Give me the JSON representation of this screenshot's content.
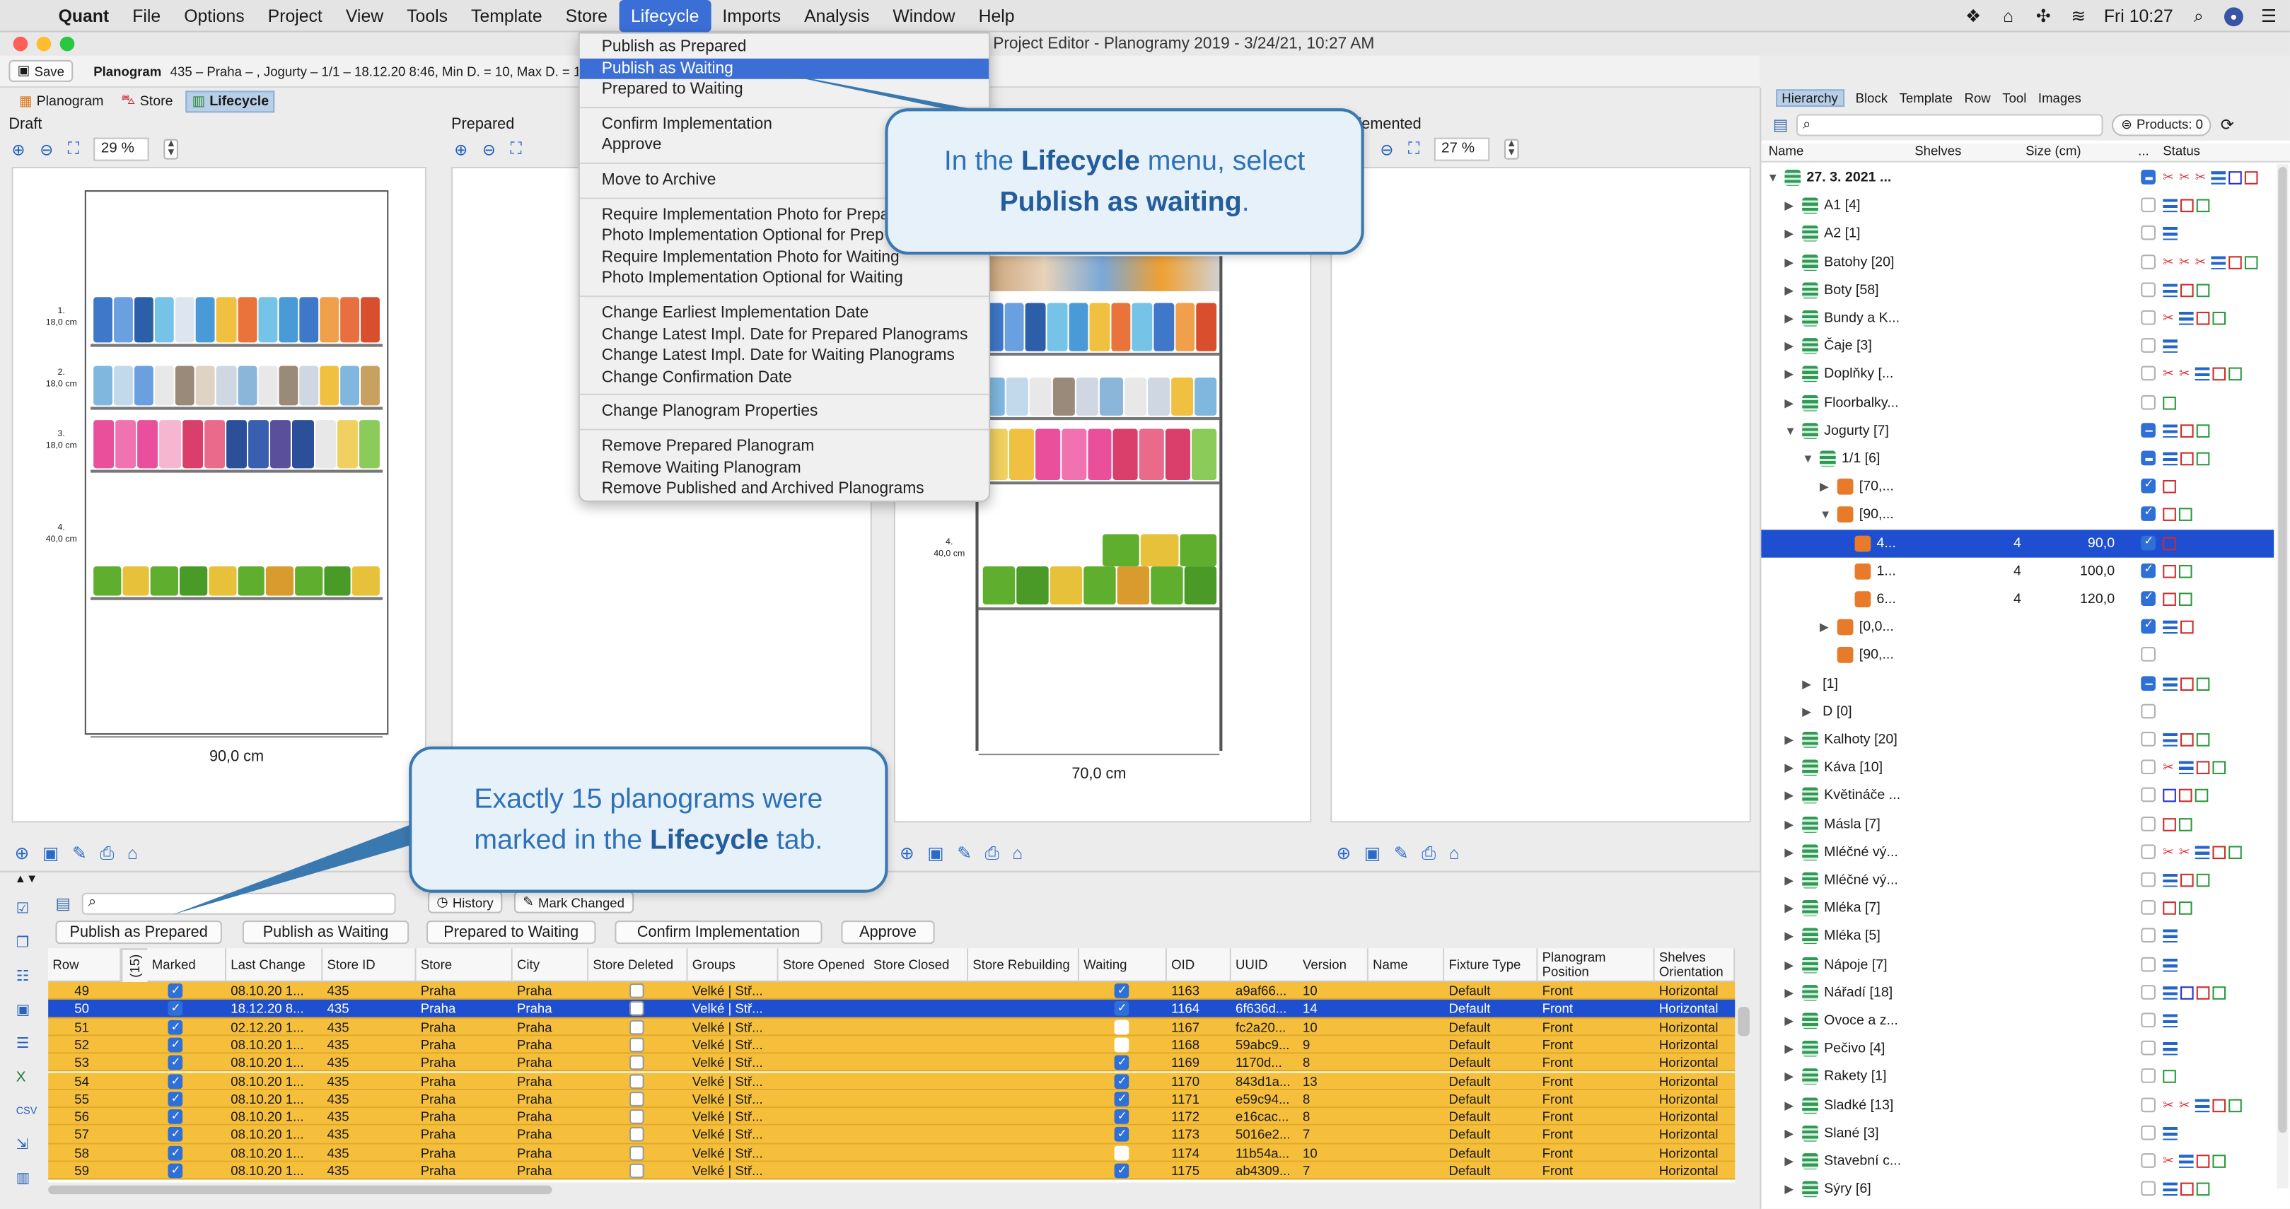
{
  "menubar": {
    "app": "Quant",
    "items": [
      "File",
      "Options",
      "Project",
      "View",
      "Tools",
      "Template",
      "Store",
      "Lifecycle",
      "Imports",
      "Analysis",
      "Window",
      "Help"
    ],
    "active": "Lifecycle",
    "clock": "Fri 10:27"
  },
  "window": {
    "title": "Project Editor - Planogramy 2019 - 3/24/21, 10:27 AM"
  },
  "toolbar": {
    "save": "Save",
    "planogram_label": "Planogram",
    "planogram_info": "435 – Praha – , Jogurty – 1/1 – 18.12.20 8:46, Min D. = 10, Max D. = 10, POPS"
  },
  "modes": {
    "planogram": "Planogram",
    "store": "Store",
    "lifecycle": "Lifecycle"
  },
  "panels": {
    "draft": {
      "title": "Draft",
      "zoom": "29 %",
      "width_label": "90,0 cm"
    },
    "prepared": {
      "title": "Prepared"
    },
    "waiting": {
      "width_label": "70,0 cm"
    },
    "implemented": {
      "title": "lemented",
      "zoom": "27 %"
    }
  },
  "shelf_labels": {
    "s1": [
      "1.",
      "18,0 cm"
    ],
    "s2": [
      "2.",
      "18,0 cm"
    ],
    "s3": [
      "3.",
      "18,0 cm"
    ],
    "s4": [
      "4.",
      "40,0 cm"
    ]
  },
  "menu": {
    "items": [
      [
        "Publish as Prepared",
        "Publish as Waiting",
        "Prepared to Waiting"
      ],
      [
        "Confirm Implementation",
        "Approve"
      ],
      [
        "Move to Archive"
      ],
      [
        "Require Implementation Photo for Prepa",
        "Photo Implementation Optional for Prep",
        "Require Implementation Photo for Waiting",
        "Photo Implementation Optional for Waiting"
      ],
      [
        "Change Earliest Implementation Date",
        "Change Latest Impl. Date for Prepared Planograms",
        "Change Latest Impl. Date for Waiting Planograms",
        "Change Confirmation Date"
      ],
      [
        "Change Planogram Properties"
      ],
      [
        "Remove Prepared Planogram",
        "Remove Waiting Planogram",
        "Remove Published and Archived Planograms"
      ]
    ],
    "highlighted": "Publish as Waiting"
  },
  "callouts": {
    "top": {
      "pre": "In the ",
      "b1": "Lifecycle",
      "mid": " menu, select",
      "b2": "Publish as waiting",
      "post": "."
    },
    "bottom": {
      "line1": "Exactly 15 planograms were",
      "pre": "marked in the ",
      "b1": "Lifecycle",
      "post": " tab."
    }
  },
  "right": {
    "tabs": [
      "Hierarchy",
      "Block",
      "Template",
      "Row",
      "Tool",
      "Images"
    ],
    "products": "Products: 0",
    "columns": {
      "name": "Name",
      "shelves": "Shelves",
      "size": "Size (cm)",
      "dots": "...",
      "status": "Status"
    },
    "rows": [
      {
        "n": "27. 3. 2021 ...",
        "lvl": 0,
        "open": true,
        "icon": "list",
        "cb": "mix",
        "st": "sc,sc,sc,lst,b,r",
        "bold": true
      },
      {
        "n": "A1 [4]",
        "lvl": 1,
        "icon": "list",
        "cb": "",
        "st": "lst,r,g"
      },
      {
        "n": "A2 [1]",
        "lvl": 1,
        "icon": "list",
        "cb": "",
        "st": "lst"
      },
      {
        "n": "Batohy [20]",
        "lvl": 1,
        "icon": "list",
        "cb": "",
        "st": "sc,sc,sc,lst,r,g"
      },
      {
        "n": "Boty [58]",
        "lvl": 1,
        "icon": "list",
        "cb": "",
        "st": "lst,r,g"
      },
      {
        "n": "Bundy a K...",
        "lvl": 1,
        "icon": "list",
        "cb": "",
        "st": "sc,lst,r,g"
      },
      {
        "n": "Čaje [3]",
        "lvl": 1,
        "icon": "list",
        "cb": "",
        "st": "lst"
      },
      {
        "n": "Doplňky [...",
        "lvl": 1,
        "icon": "list",
        "cb": "",
        "st": "sc,sc,lst,r,g"
      },
      {
        "n": "Floorbalky...",
        "lvl": 1,
        "icon": "list",
        "cb": "",
        "st": "g"
      },
      {
        "n": "Jogurty [7]",
        "lvl": 1,
        "open": true,
        "icon": "list",
        "cb": "mix",
        "st": "lst,r,g"
      },
      {
        "n": "1/1 [6]",
        "lvl": 2,
        "open": true,
        "icon": "list",
        "cb": "mix",
        "st": "lst,r,g"
      },
      {
        "n": "[70,...",
        "lvl": 3,
        "icon": "or",
        "cb": "on",
        "st": "r"
      },
      {
        "n": "[90,...",
        "lvl": 3,
        "open": true,
        "icon": "or",
        "cb": "on",
        "st": "r,g"
      },
      {
        "n": "4...",
        "lvl": 4,
        "icon": "or",
        "cb": "on",
        "sh": "4",
        "sz": "90,0",
        "st": "r",
        "sel": true
      },
      {
        "n": "1...",
        "lvl": 4,
        "icon": "or",
        "cb": "on",
        "sh": "4",
        "sz": "100,0",
        "st": "r,g"
      },
      {
        "n": "6...",
        "lvl": 4,
        "icon": "or",
        "cb": "on",
        "sh": "4",
        "sz": "120,0",
        "st": "r,g"
      },
      {
        "n": "[0,0...",
        "lvl": 3,
        "icon": "or",
        "cb": "on",
        "st": "lst,r"
      },
      {
        "n": "[90,...",
        "lvl": 3,
        "icon": "or",
        "cb": "",
        "st": ""
      },
      {
        "n": "[1]",
        "lvl": 2,
        "icon": "",
        "cb": "mix",
        "st": "lst,r,g"
      },
      {
        "n": "D [0]",
        "lvl": 2,
        "icon": "",
        "cb": "",
        "st": ""
      },
      {
        "n": "Kalhoty [20]",
        "lvl": 1,
        "icon": "list",
        "cb": "",
        "st": "lst,r,g"
      },
      {
        "n": "Káva [10]",
        "lvl": 1,
        "icon": "list",
        "cb": "",
        "st": "sc,lst,r,g"
      },
      {
        "n": "Květináče ...",
        "lvl": 1,
        "icon": "list",
        "cb": "",
        "st": "b,r,g"
      },
      {
        "n": "Másla [7]",
        "lvl": 1,
        "icon": "list",
        "cb": "",
        "st": "r,g"
      },
      {
        "n": "Mléčné vý...",
        "lvl": 1,
        "icon": "list",
        "cb": "",
        "st": "sc,sc,lst,r,g"
      },
      {
        "n": "Mléčné vý...",
        "lvl": 1,
        "icon": "list",
        "cb": "",
        "st": "lst,r,g"
      },
      {
        "n": "Mléka [7]",
        "lvl": 1,
        "icon": "list",
        "cb": "",
        "st": "r,g"
      },
      {
        "n": "Mléka [5]",
        "lvl": 1,
        "icon": "list",
        "cb": "",
        "st": "lst"
      },
      {
        "n": "Nápoje [7]",
        "lvl": 1,
        "icon": "list",
        "cb": "",
        "st": "lst"
      },
      {
        "n": "Nářadí [18]",
        "lvl": 1,
        "icon": "list",
        "cb": "",
        "st": "lst,b,r,g"
      },
      {
        "n": "Ovoce a z...",
        "lvl": 1,
        "icon": "list",
        "cb": "",
        "st": "lst"
      },
      {
        "n": "Pečivo [4]",
        "lvl": 1,
        "icon": "list",
        "cb": "",
        "st": "lst"
      },
      {
        "n": "Rakety [1]",
        "lvl": 1,
        "icon": "list",
        "cb": "",
        "st": "g"
      },
      {
        "n": "Sladké [13]",
        "lvl": 1,
        "icon": "list",
        "cb": "",
        "st": "sc,sc,lst,r,g"
      },
      {
        "n": "Slané [3]",
        "lvl": 1,
        "icon": "list",
        "cb": "",
        "st": "lst"
      },
      {
        "n": "Stavební c...",
        "lvl": 1,
        "icon": "list",
        "cb": "",
        "st": "sc,lst,r,g"
      },
      {
        "n": "Sýry [6]",
        "lvl": 1,
        "icon": "list",
        "cb": "",
        "st": "lst,r,g"
      }
    ]
  },
  "bottom": {
    "history": "History",
    "mark_changed": "Mark Changed",
    "actions": [
      "Publish as Prepared",
      "Publish as Waiting",
      "Prepared to Waiting",
      "Confirm Implementation",
      "Approve"
    ],
    "columns": [
      "Row",
      "(15)",
      "Marked",
      "Last Change",
      "Store ID",
      "Store",
      "City",
      "Store Deleted",
      "Groups",
      "Store Opened",
      "Store Closed",
      "Store Rebuilding",
      "Waiting",
      "OID",
      "UUID",
      "Version",
      "Name",
      "Fixture Type",
      "Planogram Position",
      "Shelves Orientation"
    ],
    "rows": [
      [
        "49",
        "08.10.20 1...",
        "435",
        "Praha",
        "Praha",
        "Velké | Stř...",
        true,
        "1163",
        "a9af66...",
        "10",
        "Default",
        "Front",
        "Horizontal"
      ],
      [
        "50",
        "18.12.20 8...",
        "435",
        "Praha",
        "Praha",
        "Velké | Stř...",
        true,
        "1164",
        "6f636d...",
        "14",
        "Default",
        "Front",
        "Horizontal"
      ],
      [
        "51",
        "02.12.20 1...",
        "435",
        "Praha",
        "Praha",
        "Velké | Stř...",
        false,
        "1167",
        "fc2a20...",
        "10",
        "Default",
        "Front",
        "Horizontal"
      ],
      [
        "52",
        "08.10.20 1...",
        "435",
        "Praha",
        "Praha",
        "Velké | Stř...",
        false,
        "1168",
        "59abc9...",
        "9",
        "Default",
        "Front",
        "Horizontal"
      ],
      [
        "53",
        "08.10.20 1...",
        "435",
        "Praha",
        "Praha",
        "Velké | Stř...",
        true,
        "1169",
        "1170d...",
        "8",
        "Default",
        "Front",
        "Horizontal"
      ],
      [
        "54",
        "08.10.20 1...",
        "435",
        "Praha",
        "Praha",
        "Velké | Stř...",
        true,
        "1170",
        "843d1a...",
        "13",
        "Default",
        "Front",
        "Horizontal"
      ],
      [
        "55",
        "08.10.20 1...",
        "435",
        "Praha",
        "Praha",
        "Velké | Stř...",
        true,
        "1171",
        "e59c94...",
        "8",
        "Default",
        "Front",
        "Horizontal"
      ],
      [
        "56",
        "08.10.20 1...",
        "435",
        "Praha",
        "Praha",
        "Velké | Stř...",
        true,
        "1172",
        "e16cac...",
        "8",
        "Default",
        "Front",
        "Horizontal"
      ],
      [
        "57",
        "08.10.20 1...",
        "435",
        "Praha",
        "Praha",
        "Velké | Stř...",
        true,
        "1173",
        "5016e2...",
        "7",
        "Default",
        "Front",
        "Horizontal"
      ],
      [
        "58",
        "08.10.20 1...",
        "435",
        "Praha",
        "Praha",
        "Velké | Stř...",
        false,
        "1174",
        "11b54a...",
        "10",
        "Default",
        "Front",
        "Horizontal"
      ],
      [
        "59",
        "08.10.20 1...",
        "435",
        "Praha",
        "Praha",
        "Velké | Stř...",
        true,
        "1175",
        "ab4309...",
        "7",
        "Default",
        "Front",
        "Horizontal"
      ]
    ]
  }
}
